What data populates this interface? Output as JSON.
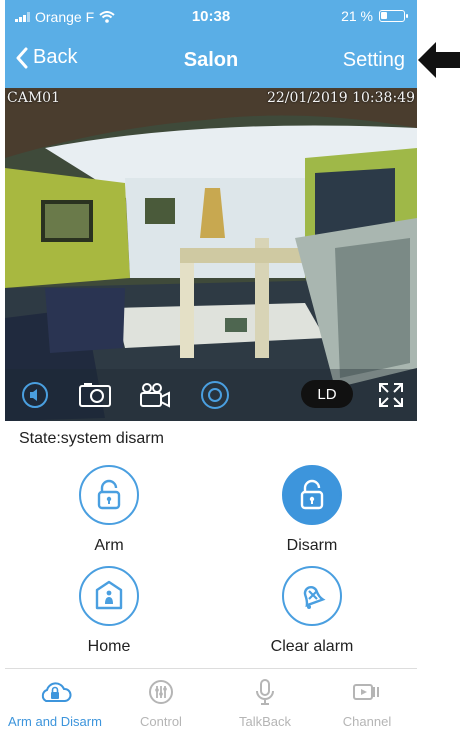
{
  "status_bar": {
    "carrier": "Orange F",
    "time": "10:38",
    "battery": "21 %"
  },
  "nav": {
    "back_label": "Back",
    "title": "Salon",
    "setting_label": "Setting"
  },
  "camera": {
    "name": "CAM01",
    "timestamp": "22/01/2019 10:38:49",
    "ld_label": "LD"
  },
  "state_text": "State:system disarm",
  "controls": [
    {
      "label": "Arm",
      "icon": "lock-open-icon"
    },
    {
      "label": "Disarm",
      "icon": "lock-open-icon"
    },
    {
      "label": "Home",
      "icon": "home-shield-icon"
    },
    {
      "label": "Clear alarm",
      "icon": "bell-cancel-icon"
    }
  ],
  "tabs": [
    {
      "label": "Arm and Disarm",
      "icon": "cloud-lock-icon"
    },
    {
      "label": "Control",
      "icon": "sliders-icon"
    },
    {
      "label": "TalkBack",
      "icon": "microphone-icon"
    },
    {
      "label": "Channel",
      "icon": "video-channel-icon"
    }
  ],
  "colors": {
    "header": "#5aaee6",
    "accent": "#3d95dc",
    "tab_inactive": "#b5b5b5"
  }
}
